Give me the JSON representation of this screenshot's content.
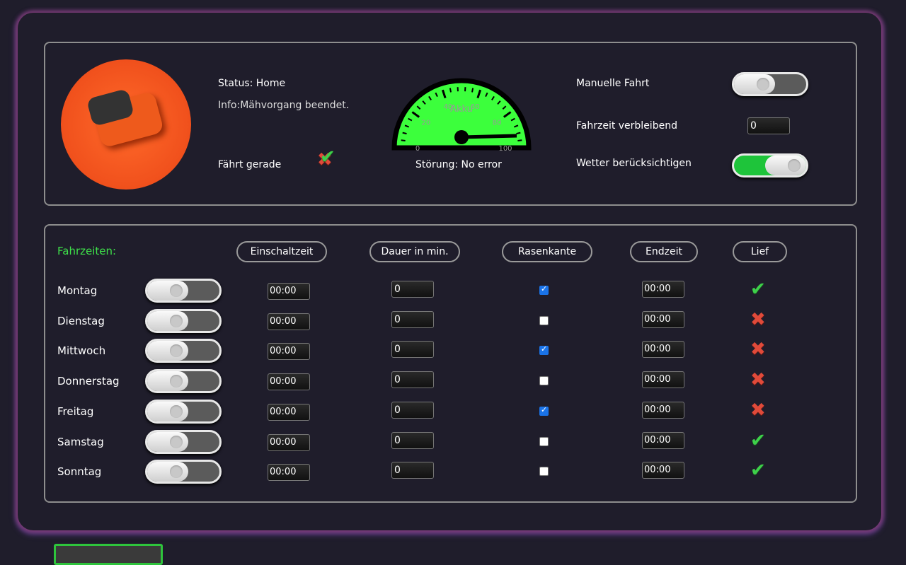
{
  "status": {
    "status": "Status: Home",
    "info": "Info:Mähvorgang beendet.",
    "straight_label": "Fährt gerade",
    "fault": "Störung: No error"
  },
  "gauge": {
    "label": "Akku",
    "ticks": [
      "0",
      "20",
      "40",
      "60",
      "80",
      "100"
    ],
    "value": 100,
    "color": "#3cff3c"
  },
  "controls": {
    "manual": "Manuelle Fahrt",
    "manual_on": false,
    "remaining_label": "Fahrzeit verbleibend",
    "remaining_value": "0",
    "weather": "Wetter berücksichtigen",
    "weather_on": true
  },
  "schedule": {
    "title": "Fahrzeiten:",
    "headers": [
      "Einschaltzeit",
      "Dauer in min.",
      "Rasenkante",
      "Endzeit",
      "Lief"
    ],
    "rows": [
      {
        "day": "Montag",
        "start": "00:00",
        "duration": "0",
        "edge": true,
        "end": "00:00",
        "ran": true
      },
      {
        "day": "Dienstag",
        "start": "00:00",
        "duration": "0",
        "edge": false,
        "end": "00:00",
        "ran": false
      },
      {
        "day": "Mittwoch",
        "start": "00:00",
        "duration": "0",
        "edge": true,
        "end": "00:00",
        "ran": false
      },
      {
        "day": "Donnerstag",
        "start": "00:00",
        "duration": "0",
        "edge": false,
        "end": "00:00",
        "ran": false
      },
      {
        "day": "Freitag",
        "start": "00:00",
        "duration": "0",
        "edge": true,
        "end": "00:00",
        "ran": false
      },
      {
        "day": "Samstag",
        "start": "00:00",
        "duration": "0",
        "edge": false,
        "end": "00:00",
        "ran": true
      },
      {
        "day": "Sonntag",
        "start": "00:00",
        "duration": "0",
        "edge": false,
        "end": "00:00",
        "ran": true
      }
    ]
  }
}
